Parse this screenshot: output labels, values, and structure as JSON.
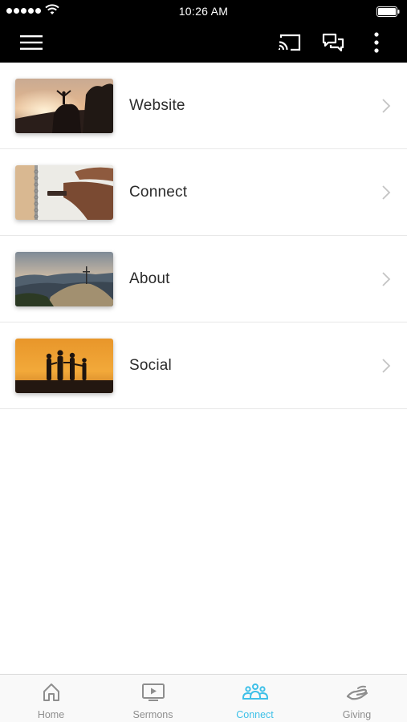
{
  "status_bar": {
    "time": "10:26 AM"
  },
  "list": {
    "items": [
      {
        "label": "Website"
      },
      {
        "label": "Connect"
      },
      {
        "label": "About"
      },
      {
        "label": "Social"
      }
    ]
  },
  "tab_bar": {
    "active": "Connect",
    "accent_color": "#3ec0e8",
    "inactive_color": "#8e8e8e",
    "tabs": [
      {
        "label": "Home",
        "icon": "home-icon"
      },
      {
        "label": "Sermons",
        "icon": "play-screen-icon"
      },
      {
        "label": "Connect",
        "icon": "people-group-icon"
      },
      {
        "label": "Giving",
        "icon": "hand-giving-icon"
      }
    ]
  },
  "app_bar": {
    "icons": [
      "menu-icon",
      "cast-icon",
      "chat-icon",
      "more-vertical-icon"
    ]
  }
}
